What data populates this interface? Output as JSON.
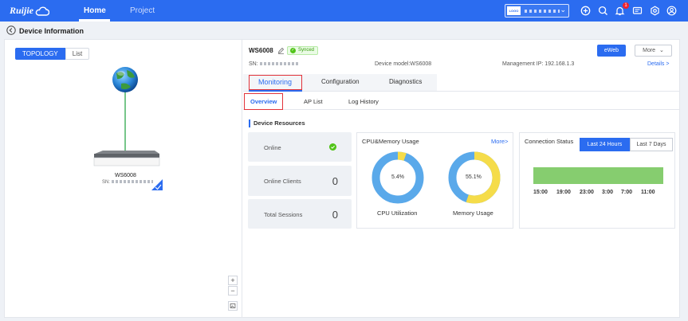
{
  "header": {
    "logo": "Ruijie",
    "nav": [
      {
        "label": "Home"
      },
      {
        "label": "Project"
      }
    ],
    "account_flag": "LOGO",
    "notification_count": "1"
  },
  "page": {
    "title": "Device Information"
  },
  "topology": {
    "toggle": [
      "TOPOLOGY",
      "List"
    ],
    "device_name": "WS6008",
    "device_sn_prefix": "SN:",
    "zoom_in": "+",
    "zoom_out": "−"
  },
  "device": {
    "name": "WS6008",
    "sync_status": "Synced",
    "sn_label": "SN:",
    "model_label": "Device model:WS6008",
    "mgmt_ip_label": "Management IP:  192.168.1.3",
    "details_link": "Details >",
    "eweb_button": "eWeb",
    "more_button": "More"
  },
  "tabs": [
    {
      "label": "Monitoring"
    },
    {
      "label": "Configuration"
    },
    {
      "label": "Diagnostics"
    }
  ],
  "subtabs": [
    {
      "label": "Overview"
    },
    {
      "label": "AP List"
    },
    {
      "label": "Log History"
    }
  ],
  "resources": {
    "heading": "Device Resources",
    "stats": [
      {
        "label": "Online",
        "value": ""
      },
      {
        "label": "Online Clients",
        "value": "0"
      },
      {
        "label": "Total Sessions",
        "value": "0"
      }
    ],
    "cpu_mem": {
      "title": "CPU&Memory Usage",
      "more": "More>",
      "cpu_value": "5.4%",
      "cpu_fraction": 0.054,
      "cpu_label": "CPU Utilization",
      "mem_value": "55.1%",
      "mem_fraction": 0.551,
      "mem_label": "Memory Usage"
    },
    "connection": {
      "title": "Connection Status",
      "ranges": [
        "Last 24 Hours",
        "Last 7 Days"
      ],
      "times": [
        "15:00",
        "19:00",
        "23:00",
        "3:00",
        "7:00",
        "11:00"
      ]
    }
  },
  "colors": {
    "accent": "#2b6cf0",
    "online": "#52c41a",
    "donut_free": "#5aa9ea",
    "donut_used": "#f5dc4a",
    "conn_bar": "#86cd6f"
  }
}
